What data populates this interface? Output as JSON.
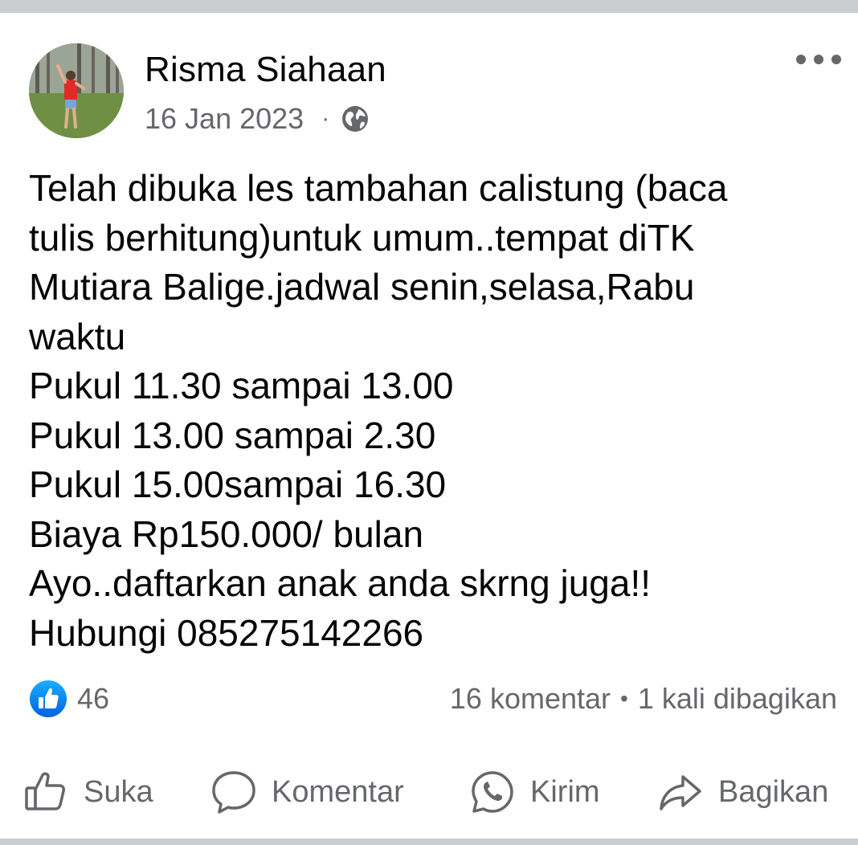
{
  "post": {
    "author": "Risma Siahaan",
    "date": "16 Jan 2023",
    "separator": "·",
    "privacy_icon": "globe-icon",
    "menu_icon": "more-options-icon",
    "body_lines": [
      "Telah dibuka les tambahan calistung (baca",
      "tulis berhitung)untuk umum..tempat diTK",
      "Mutiara Balige.jadwal senin,selasa,Rabu",
      "waktu",
      "Pukul 11.30 sampai 13.00",
      "Pukul 13.00 sampai 2.30",
      "Pukul 15.00sampai 16.30",
      "Biaya Rp150.000/ bulan",
      "Ayo..daftarkan anak anda skrng juga!!",
      "Hubungi 085275142266"
    ]
  },
  "engagement": {
    "reaction_icon": "like-reaction-icon",
    "reaction_count": "46",
    "comments": "16 komentar",
    "stats_separator": "•",
    "shares": "1 kali dibagikan"
  },
  "actions": {
    "like": {
      "label": "Suka",
      "icon": "thumbs-up-icon"
    },
    "comment": {
      "label": "Komentar",
      "icon": "comment-bubble-icon"
    },
    "send": {
      "label": "Kirim",
      "icon": "whatsapp-icon"
    },
    "share": {
      "label": "Bagikan",
      "icon": "share-arrow-icon"
    }
  },
  "colors": {
    "text_primary": "#050505",
    "text_secondary": "#65676b",
    "like_blue": "#1877f2",
    "divider": "#c9ccd1"
  }
}
